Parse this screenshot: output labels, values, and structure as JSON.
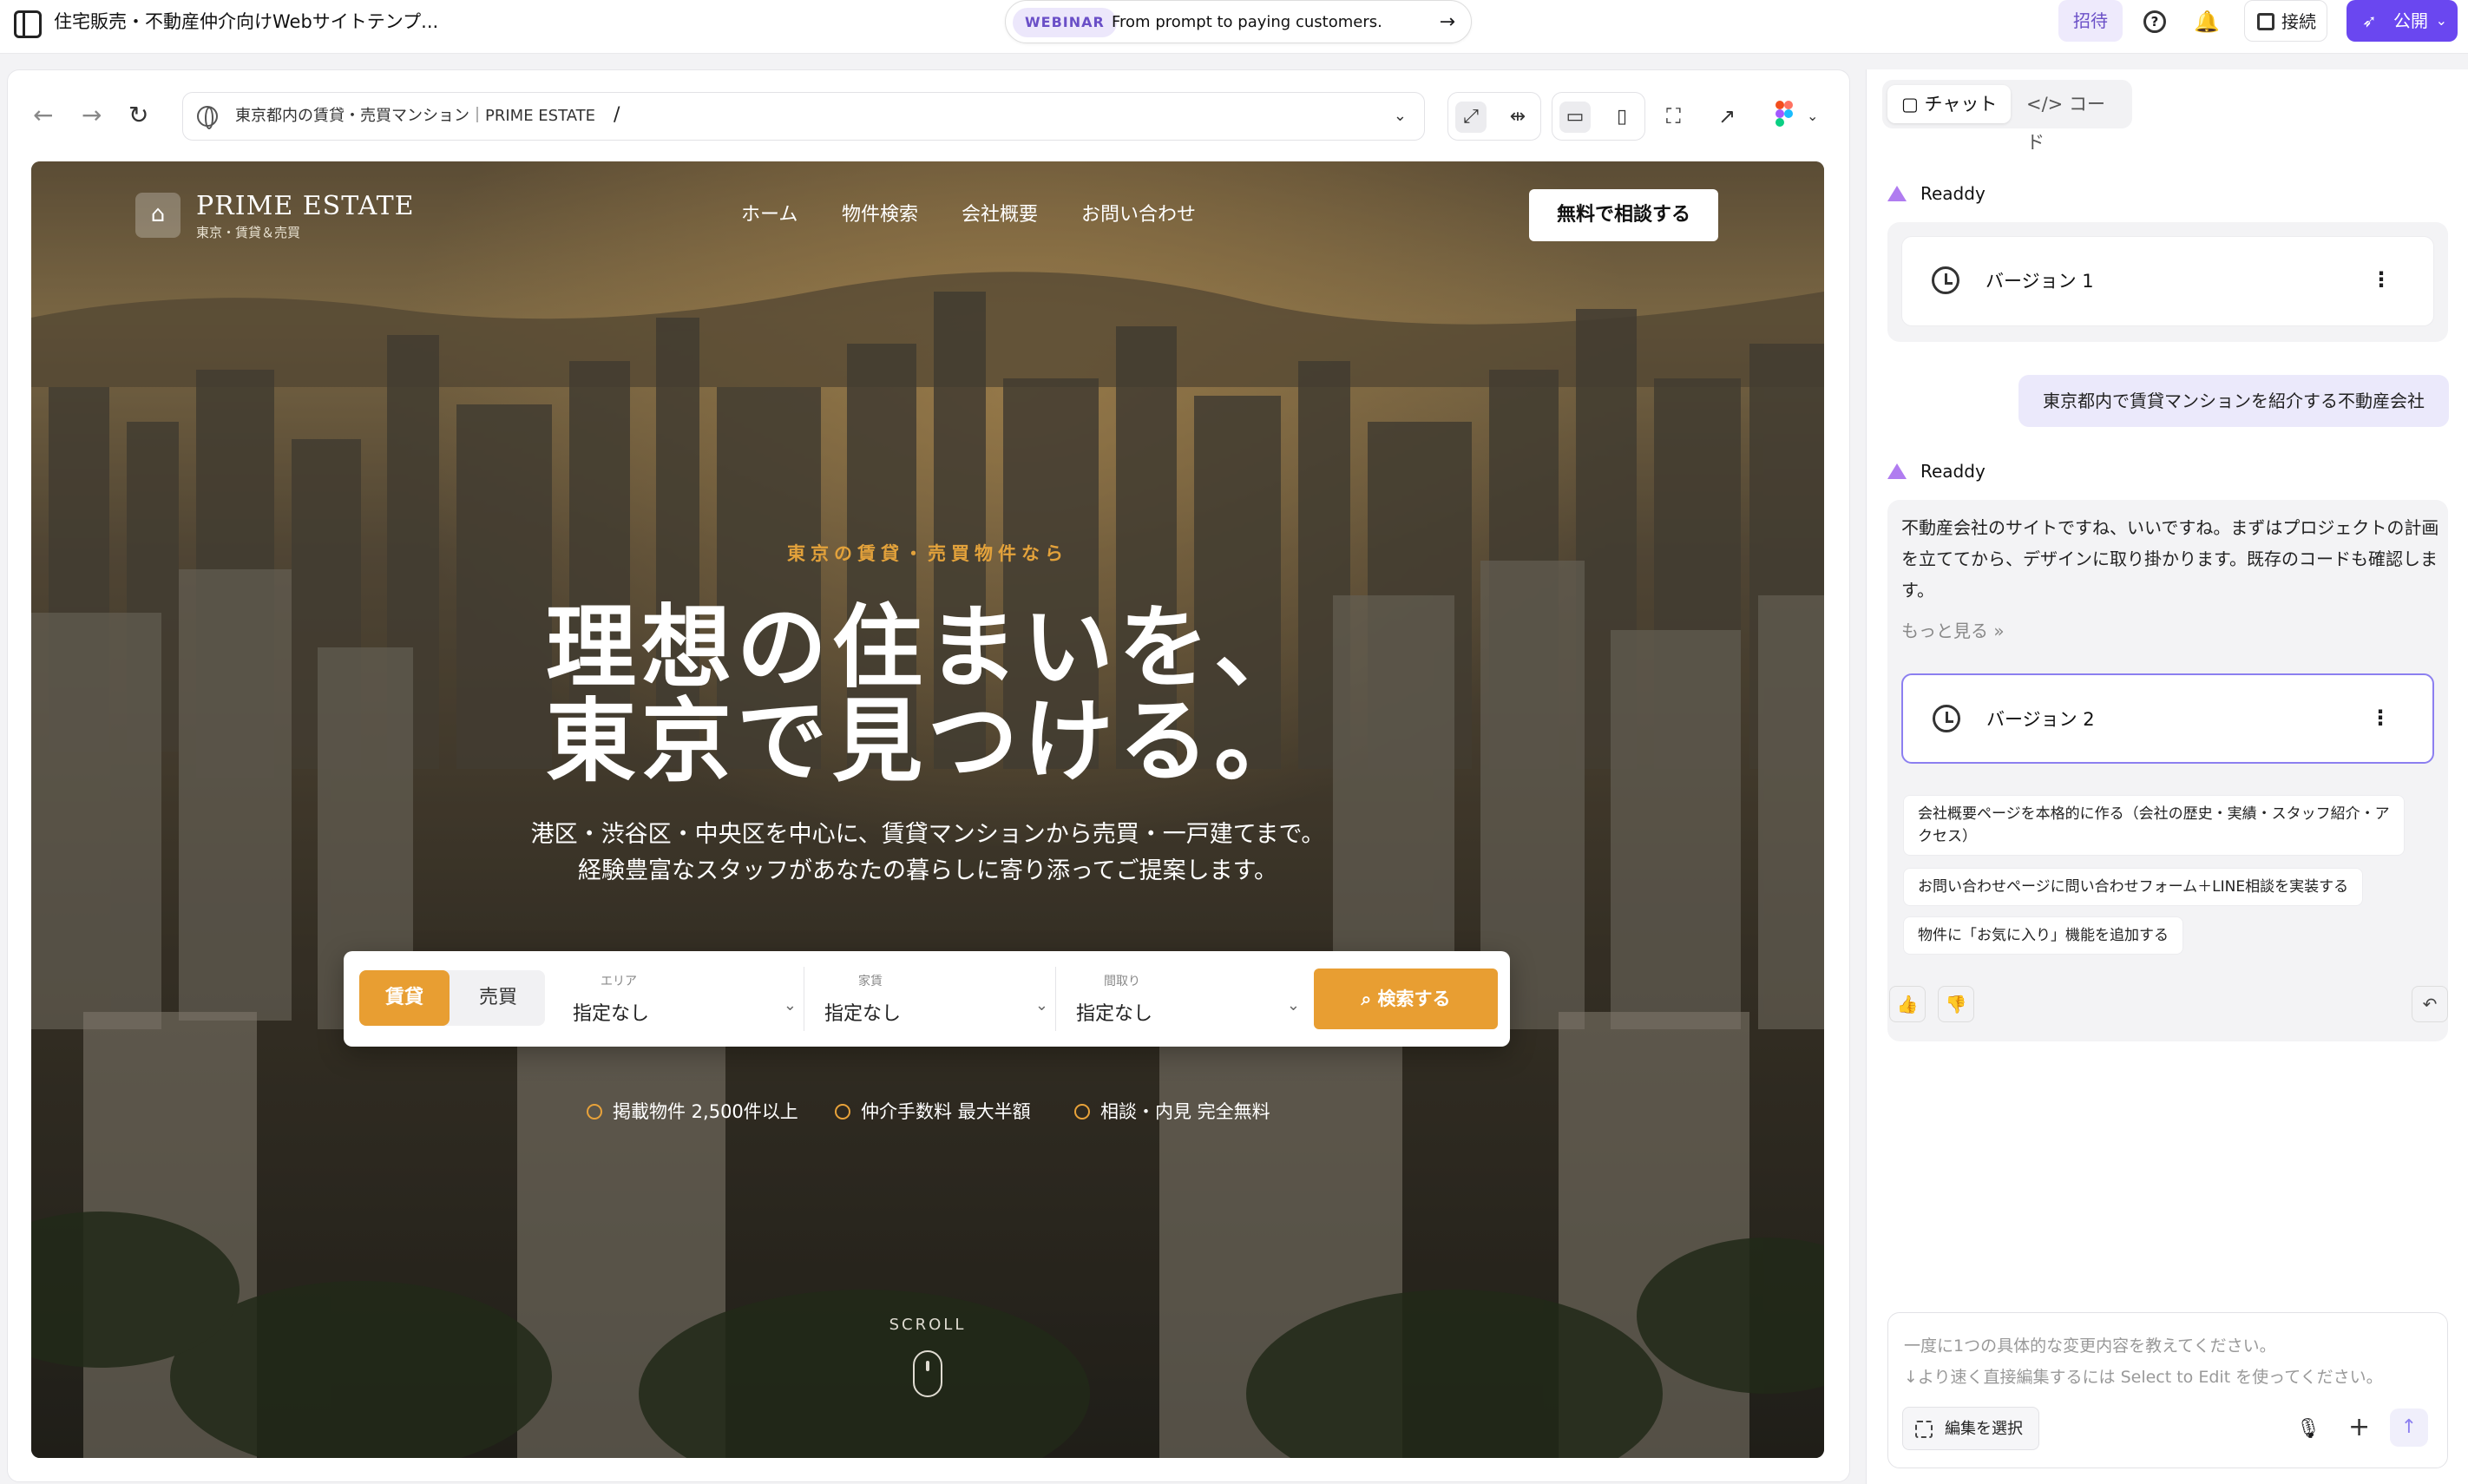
{
  "topbar": {
    "project_title": "住宅販売・不動産仲介向けWebサイトテンプ...",
    "webinar_tag": "WEBINAR",
    "webinar_text": "From prompt to paying customers.",
    "invite": "招待",
    "connect": "接続",
    "publish": "公開",
    "accent": "#6a47f0"
  },
  "browser": {
    "url_site": "東京都内の賃貸・売買マンション｜PRIME ESTATE",
    "url_path": "/"
  },
  "site": {
    "brand": "PRIME ESTATE",
    "brand_sub": "東京・賃貸＆売買",
    "nav": [
      "ホーム",
      "物件検索",
      "会社概要",
      "お問い合わせ"
    ],
    "cta": "無料で相談する",
    "eyebrow": "東京の賃貸・売買物件なら",
    "headline_1": "理想の住まいを、",
    "headline_2": "東京で見つける。",
    "lead_1": "港区・渋谷区・中央区を中心に、賃貸マンションから売買・一戸建てまで。",
    "lead_2": "経験豊富なスタッフがあなたの暮らしに寄り添ってご提案します。",
    "search": {
      "tab_rent": "賃貸",
      "tab_buy": "売買",
      "area_label": "エリア",
      "area_value": "指定なし",
      "rent_label": "家賃",
      "rent_value": "指定なし",
      "layout_label": "間取り",
      "layout_value": "指定なし",
      "button": "検索する"
    },
    "features": [
      "掲載物件 2,500件以上",
      "仲介手数料 最大半額",
      "相談・内見 完全無料"
    ],
    "scroll": "SCROLL",
    "accent": "#e89e32"
  },
  "chat": {
    "tab_chat": "チャット",
    "tab_code": "コード",
    "bot_name": "Readdy",
    "version1": "バージョン 1",
    "user_message": "東京都内で賃貸マンションを紹介する不動産会社",
    "bot_reply": "不動産会社のサイトですね、いいですね。まずはプロジェクトの計画を立ててから、デザインに取り掛かります。既存のコードも確認します。",
    "more": "もっと見る",
    "version2": "バージョン 2",
    "suggestions": [
      "会社概要ページを本格的に作る（会社の歴史・実績・スタッフ紹介・アクセス）",
      "お問い合わせページに問い合わせフォーム＋LINE相談を実装する",
      "物件に「お気に入り」機能を追加する"
    ],
    "input_placeholder_1": "一度に1つの具体的な変更内容を教えてください。",
    "input_placeholder_2": "↓より速く直接編集するには Select to Edit を使ってください。",
    "select_edit": "編集を選択"
  }
}
